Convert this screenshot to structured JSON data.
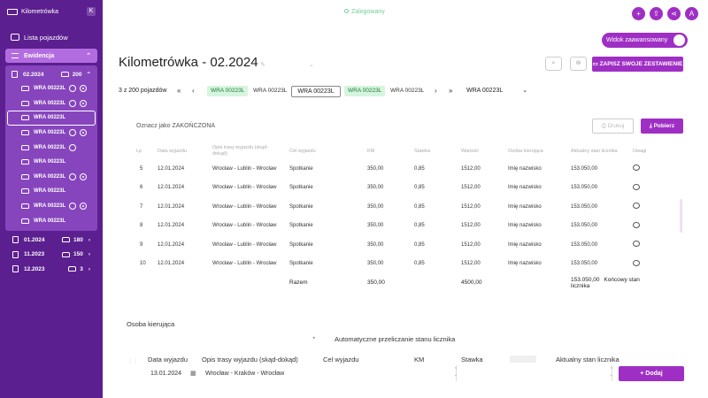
{
  "sidebar": {
    "app_name": "Kilometrówka",
    "collapse_glyph": "K",
    "vehicles_link": "Lista pojazdów",
    "section": "Ewidencja",
    "active_month": {
      "label": "02.2024",
      "count": "200"
    },
    "items": [
      {
        "plate": "WRA 00223L",
        "check": true,
        "veh": true
      },
      {
        "plate": "WRA 00223L",
        "check": true,
        "veh": true
      },
      {
        "plate": "WRA 00223L",
        "check": false,
        "veh": false,
        "active": true
      },
      {
        "plate": "WRA 00223L",
        "check": true,
        "veh": true
      },
      {
        "plate": "WRA 00223L",
        "check": true,
        "veh": false
      },
      {
        "plate": "WRA 00223L",
        "check": false,
        "veh": false
      },
      {
        "plate": "WRA 00223L",
        "check": true,
        "veh": true
      },
      {
        "plate": "WRA 00223L",
        "check": false,
        "veh": false
      },
      {
        "plate": "WRA 00223L",
        "check": true,
        "veh": true
      },
      {
        "plate": "WRA 00223L",
        "check": false,
        "veh": false
      }
    ],
    "months": [
      {
        "label": "01.2024",
        "count": "180"
      },
      {
        "label": "11.2023",
        "count": "150"
      },
      {
        "label": "12.2023",
        "count": "3"
      }
    ]
  },
  "header": {
    "status": "Zalogowany",
    "avatar": "A",
    "advanced_toggle": "Widok zaawansowany",
    "title": "Kilometrówka - 02.2024",
    "save_button": "ZAPISZ SWOJE ZESTAWIENIE"
  },
  "pager": {
    "count": "3 z 200 pojazdów",
    "chips": [
      "WRA 00223L",
      "WRA 00223L",
      "WRA 00223L",
      "WRA 00223L",
      "WRA 00223L"
    ],
    "selected": "WRA 00223L"
  },
  "actions": {
    "mark_done": "Oznacz jako ZAKOŃCZONA",
    "print": "Drukuj",
    "download": "Pobierz"
  },
  "table": {
    "headers": [
      "Lp",
      "Data wyjazdu",
      "Opis trasy wyjazdu (skąd-dokąd)",
      "Cel wyjazdu",
      "KM",
      "Stawka",
      "Wartość",
      "Osoba kierująca",
      "Aktualny stan licznika",
      "Uwagi"
    ],
    "rows": [
      [
        "5",
        "12.01.2024",
        "Wrocław - Lublin - Wrocław",
        "Spotkanie",
        "350,00",
        "0,85",
        "1512,00",
        "Imię nazwisko",
        "153.050,00"
      ],
      [
        "6",
        "12.01.2024",
        "Wrocław - Lublin - Wrocław",
        "Spotkanie",
        "350,00",
        "0,85",
        "1512,00",
        "Imię nazwisko",
        "153.050,00"
      ],
      [
        "7",
        "12.01.2024",
        "Wrocław - Lublin - Wrocław",
        "Spotkanie",
        "350,00",
        "0,85",
        "1512,00",
        "Imię nazwisko",
        "153.050,00"
      ],
      [
        "8",
        "12.01.2024",
        "Wrocław - Lublin - Wrocław",
        "Spotkanie",
        "350,00",
        "0,85",
        "1512,00",
        "Imię nazwisko",
        "153.050,00"
      ],
      [
        "9",
        "12.01.2024",
        "Wrocław - Lublin - Wrocław",
        "Spotkanie",
        "350,00",
        "0,85",
        "1512,00",
        "Imię nazwisko",
        "153.050,00"
      ],
      [
        "10",
        "12.01.2024",
        "Wrocław - Lublin - Wrocław",
        "Spotkanie",
        "350,00",
        "0,85",
        "1512,00",
        "Imię nazwisko",
        "153.050,00"
      ]
    ],
    "summary": {
      "label": "Razem",
      "km": "350,00",
      "value": "4500,00",
      "meter": "153.050,00",
      "meter_label": "Końcowy stan licznika"
    }
  },
  "form": {
    "section_label": "Osoba kierująca",
    "auto_recalc": "Automatyczne przeliczanie stanu licznika",
    "headers": [
      "Data wyjazdu",
      "Opis trasy wyjazdu (skąd-dokąd)",
      "Cel wyjazdu",
      "KM",
      "Stawka",
      "Aktualny stan licznika"
    ],
    "date_value": "13.01.2024",
    "route_value": "Wrocław - Kraków - Wrocław",
    "add_button": "Dodaj"
  },
  "colors": {
    "sidebar": "#5b1f8f",
    "accent": "#9f2fc4",
    "chip_green": "#d6f5de"
  }
}
